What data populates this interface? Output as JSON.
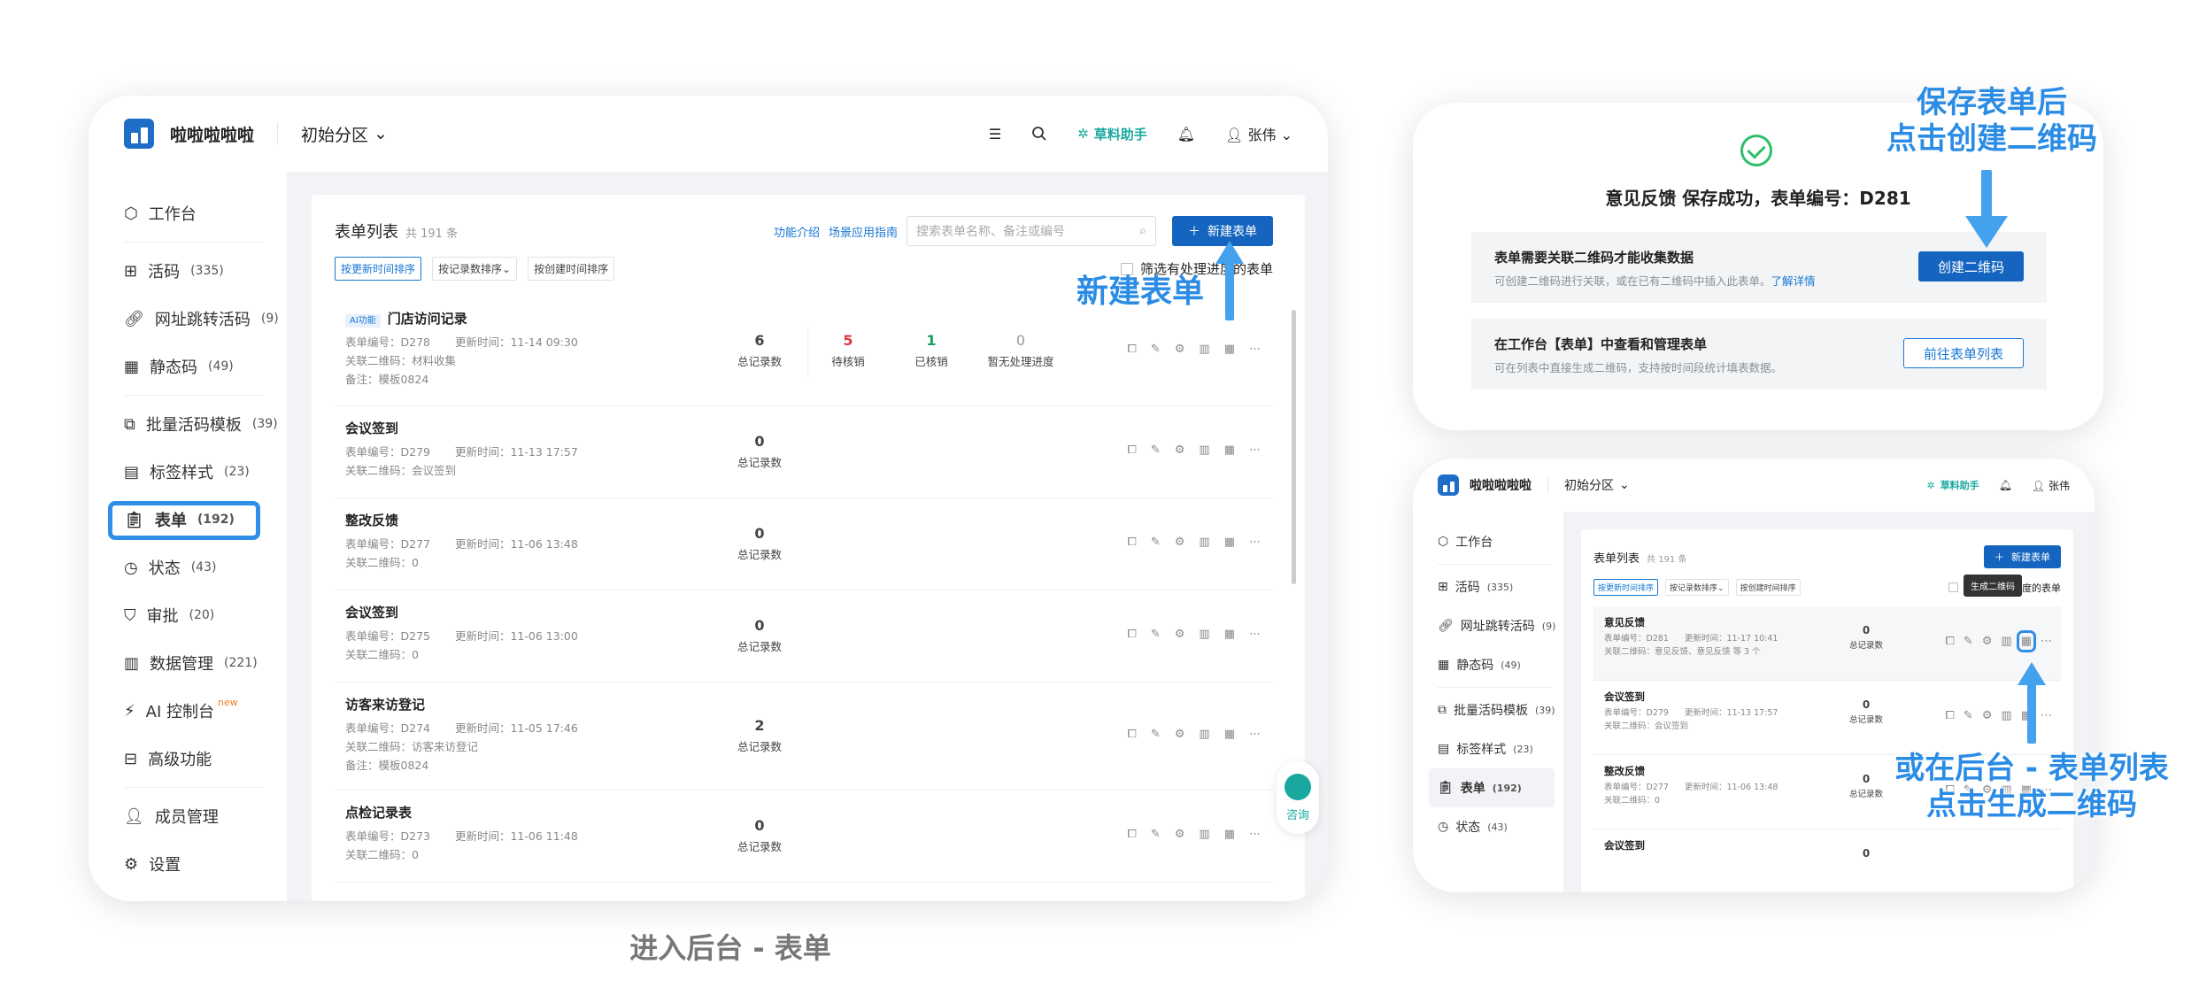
{
  "main": {
    "app_name": "啦啦啦啦啦",
    "zone": "初始分区",
    "assistant": "草料助手",
    "user": "张伟",
    "sidebar": [
      {
        "label": "工作台",
        "count": ""
      },
      {
        "label": "活码",
        "count": "(335)"
      },
      {
        "label": "网址跳转活码",
        "count": "(9)"
      },
      {
        "label": "静态码",
        "count": "(49)"
      },
      {
        "label": "批量活码模板",
        "count": "(39)"
      },
      {
        "label": "标签样式",
        "count": "(23)"
      },
      {
        "label": "表单",
        "count": "(192)"
      },
      {
        "label": "状态",
        "count": "(43)"
      },
      {
        "label": "审批",
        "count": "(20)"
      },
      {
        "label": "数据管理",
        "count": "(221)"
      },
      {
        "label": "AI 控制台",
        "count": "",
        "badge": "new"
      },
      {
        "label": "高级功能",
        "count": ""
      },
      {
        "label": "成员管理",
        "count": ""
      },
      {
        "label": "设置",
        "count": ""
      }
    ],
    "list_title": "表单列表",
    "list_count": "共 191 条",
    "link_intro": "功能介绍",
    "link_guide": "场景应用指南",
    "search_placeholder": "搜索表单名称、备注或编号",
    "new_button": "新建表单",
    "sort_time": "按更新时间排序",
    "sort_count": "按记录数排序",
    "sort_created": "按创建时间排序",
    "filter_label": "筛选有处理进度的表单",
    "rows": [
      {
        "ai": "AI功能",
        "title": "门店访问记录",
        "code": "表单编号：D278",
        "updated": "更新时间：11-14 09:30",
        "qr": "关联二维码：材料收集",
        "note": "备注：模板0824",
        "total": "6",
        "total_label": "总记录数",
        "pending": "5",
        "pending_label": "待核销",
        "done": "1",
        "done_label": "已核销",
        "none": "0",
        "none_label": "暂无处理进度"
      },
      {
        "title": "会议签到",
        "code": "表单编号：D279",
        "updated": "更新时间：11-13 17:57",
        "qr": "关联二维码：会议签到",
        "total": "0",
        "total_label": "总记录数"
      },
      {
        "title": "整改反馈",
        "code": "表单编号：D277",
        "updated": "更新时间：11-06 13:48",
        "qr": "关联二维码：0",
        "total": "0",
        "total_label": "总记录数"
      },
      {
        "title": "会议签到",
        "code": "表单编号：D275",
        "updated": "更新时间：11-06 13:00",
        "qr": "关联二维码：0",
        "total": "0",
        "total_label": "总记录数"
      },
      {
        "title": "访客来访登记",
        "code": "表单编号：D274",
        "updated": "更新时间：11-05 17:46",
        "qr": "关联二维码：访客来访登记",
        "note": "备注：模板0824",
        "total": "2",
        "total_label": "总记录数"
      },
      {
        "title": "点检记录表",
        "code": "表单编号：D273",
        "updated": "更新时间：11-06 11:48",
        "qr": "关联二维码：0",
        "total": "0",
        "total_label": "总记录数"
      }
    ],
    "consult": "咨询"
  },
  "annotations": {
    "new_form": "新建表单",
    "save_then_create_1": "保存表单后",
    "save_then_create_2": "点击创建二维码",
    "or_list_1": "或在后台 - 表单列表",
    "or_list_2": "点击生成二维码",
    "caption": "进入后台 - 表单"
  },
  "success": {
    "title": "意见反馈 保存成功，表单编号：D281",
    "box1_title": "表单需要关联二维码才能收集数据",
    "box1_desc": "可创建二维码进行关联，或在已有二维码中插入此表单。",
    "box1_link": "了解详情",
    "box1_button": "创建二维码",
    "box2_title": "在工作台【表单】中查看和管理表单",
    "box2_desc": "可在列表中直接生成二维码，支持按时间段统计填表数据。",
    "box2_button": "前往表单列表"
  },
  "mini": {
    "app_name": "啦啦啦啦啦",
    "zone": "初始分区",
    "assistant": "草料助手",
    "user": "张伟",
    "sidebar": [
      {
        "label": "工作台",
        "count": ""
      },
      {
        "label": "活码",
        "count": "(335)"
      },
      {
        "label": "网址跳转活码",
        "count": "(9)"
      },
      {
        "label": "静态码",
        "count": "(49)"
      },
      {
        "label": "批量活码模板",
        "count": "(39)"
      },
      {
        "label": "标签样式",
        "count": "(23)"
      },
      {
        "label": "表单",
        "count": "(192)"
      },
      {
        "label": "状态",
        "count": "(43)"
      }
    ],
    "list_title": "表单列表",
    "list_count": "共 191 条",
    "new_button": "新建表单",
    "sort_time": "按更新时间排序",
    "sort_count": "按记录数排序",
    "sort_created": "按创建时间排序",
    "filter_label": "筛选有处理进度的表单",
    "tooltip": "生成二维码",
    "rows": [
      {
        "title": "意见反馈",
        "code": "表单编号：D281",
        "updated": "更新时间：11-17 10:41",
        "qr": "关联二维码：意见反馈、意见反馈 等 3 个",
        "total": "0",
        "total_label": "总记录数"
      },
      {
        "title": "会议签到",
        "code": "表单编号：D279",
        "updated": "更新时间：11-13 17:57",
        "qr": "关联二维码：会议签到",
        "total": "0",
        "total_label": "总记录数"
      },
      {
        "title": "整改反馈",
        "code": "表单编号：D277",
        "updated": "更新时间：11-06 13:48",
        "qr": "关联二维码：0",
        "total": "0",
        "total_label": "总记录数"
      },
      {
        "title": "会议签到",
        "code": "",
        "updated": "",
        "qr": "",
        "total": "0",
        "total_label": ""
      }
    ]
  },
  "colors": {
    "accent": "#1565c0",
    "annotation": "#2b8ce6",
    "success": "#2fbf6b",
    "pending": "#e0393e",
    "done": "#1b9e5a"
  }
}
